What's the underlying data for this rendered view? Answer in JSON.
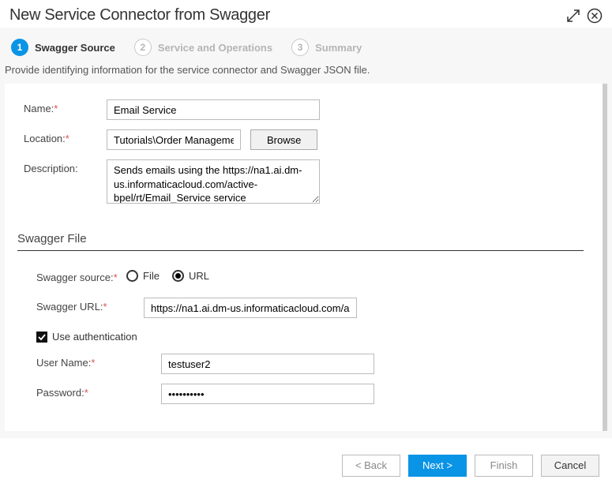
{
  "header": {
    "title": "New Service Connector from Swagger"
  },
  "steps": [
    {
      "num": "1",
      "label": "Swagger Source",
      "state": "active"
    },
    {
      "num": "2",
      "label": "Service and Operations",
      "state": "inactive"
    },
    {
      "num": "3",
      "label": "Summary",
      "state": "inactive"
    }
  ],
  "instruction": "Provide identifying information for the service connector and Swagger JSON file.",
  "form": {
    "name_label": "Name:",
    "name_value": "Email Service",
    "location_label": "Location:",
    "location_value": "Tutorials\\Order Manageme",
    "browse_label": "Browse",
    "description_label": "Description:",
    "description_value": "Sends emails using the https://na1.ai.dm-us.informaticacloud.com/active-bpel/rt/Email_Service service"
  },
  "swagger": {
    "section_title": "Swagger File",
    "source_label": "Swagger source:",
    "options": {
      "file": "File",
      "url": "URL"
    },
    "selected": "url",
    "url_label": "Swagger URL:",
    "url_value": "https://na1.ai.dm-us.informaticacloud.com/ac",
    "auth_label": "Use authentication",
    "auth_checked": true,
    "user_label": "User Name:",
    "user_value": "testuser2",
    "pass_label": "Password:",
    "pass_value": "••••••••••"
  },
  "footer": {
    "back": "< Back",
    "next": "Next >",
    "finish": "Finish",
    "cancel": "Cancel"
  }
}
